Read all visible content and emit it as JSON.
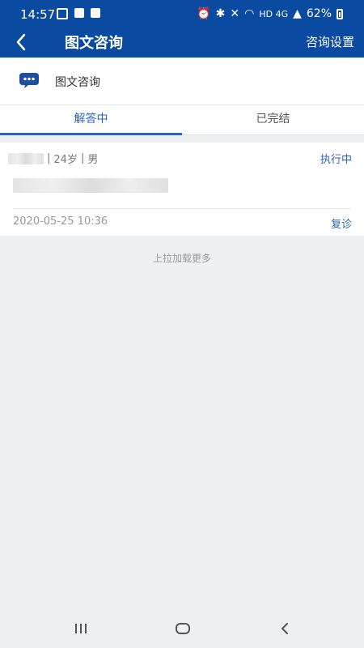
{
  "status_bar": {
    "time": "14:57",
    "battery": "62%",
    "network": "HD 4G"
  },
  "nav": {
    "title": "图文咨询",
    "settings_label": "咨询设置",
    "accent_color": "#0a4aa0"
  },
  "header": {
    "label": "图文咨询",
    "icon": "chat-bubble-icon"
  },
  "tabs": [
    {
      "label": "解答中",
      "active": true
    },
    {
      "label": "已完结",
      "active": false
    }
  ],
  "consultation": {
    "age": "24岁",
    "gender": "男",
    "status": "执行中",
    "time": "2020-05-25 10:36",
    "action_label": "复诊"
  },
  "load_more": "上拉加载更多"
}
